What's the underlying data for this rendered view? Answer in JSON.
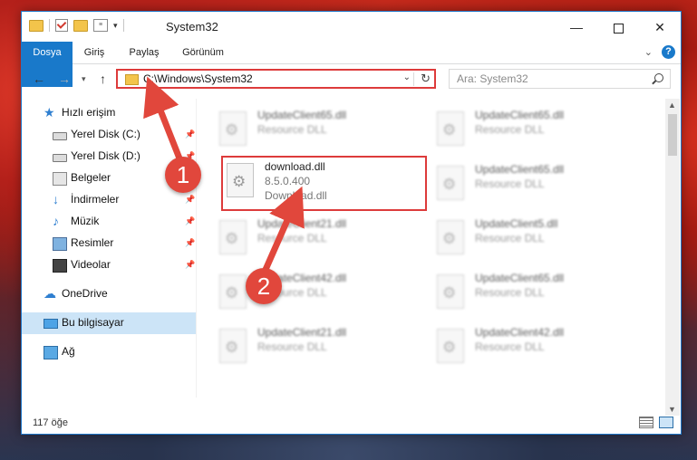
{
  "window": {
    "title": "System32",
    "controls": {
      "minimize": "—",
      "maximize": "",
      "close": "✕"
    }
  },
  "ribbon": {
    "tabs": [
      {
        "label": "Dosya"
      },
      {
        "label": "Giriş"
      },
      {
        "label": "Paylaş"
      },
      {
        "label": "Görünüm"
      }
    ],
    "help": "?"
  },
  "navigation": {
    "address": "C:\\Windows\\System32",
    "search_placeholder": "Ara: System32"
  },
  "sidebar": {
    "items": [
      {
        "label": "Hızlı erişim",
        "icon": "star-icon"
      },
      {
        "label": "Yerel Disk (C:)",
        "icon": "disk-icon",
        "pinned": true
      },
      {
        "label": "Yerel Disk (D:)",
        "icon": "disk-icon",
        "pinned": true
      },
      {
        "label": "Belgeler",
        "icon": "documents-icon",
        "pinned": true
      },
      {
        "label": "İndirmeler",
        "icon": "downloads-icon",
        "pinned": true
      },
      {
        "label": "Müzik",
        "icon": "music-icon",
        "pinned": true
      },
      {
        "label": "Resimler",
        "icon": "pictures-icon",
        "pinned": true
      },
      {
        "label": "Videolar",
        "icon": "videos-icon",
        "pinned": true
      },
      {
        "label": "OneDrive",
        "icon": "onedrive-icon"
      },
      {
        "label": "Bu bilgisayar",
        "icon": "computer-icon",
        "selected": true
      },
      {
        "label": "Ağ",
        "icon": "network-icon"
      }
    ]
  },
  "files": [
    {
      "name": "UpdateClient65.dll",
      "type": "Resource DLL"
    },
    {
      "name": "UpdateClient65.dll",
      "type": "Resource DLL"
    },
    {
      "name": "download.dll",
      "version": "8.5.0.400",
      "type": "Download.dll",
      "highlighted": true
    },
    {
      "name": "UpdateClient65.dll",
      "type": "Resource DLL"
    },
    {
      "name": "UpdateClient21.dll",
      "type": "Resource DLL"
    },
    {
      "name": "UpdateClient5.dll",
      "type": "Resource DLL"
    },
    {
      "name": "UpdateClient42.dll",
      "type": "Resource DLL"
    },
    {
      "name": "UpdateClient65.dll",
      "type": "Resource DLL"
    },
    {
      "name": "UpdateClient21.dll",
      "type": "Resource DLL"
    },
    {
      "name": "UpdateClient42.dll",
      "type": "Resource DLL"
    }
  ],
  "status": {
    "item_count": "117 öğe"
  },
  "annotations": [
    {
      "number": "1"
    },
    {
      "number": "2"
    }
  ],
  "colors": {
    "accent": "#1979ca",
    "highlight": "#dd3b3b",
    "badge": "#e1473c",
    "selection": "#cce4f7"
  }
}
